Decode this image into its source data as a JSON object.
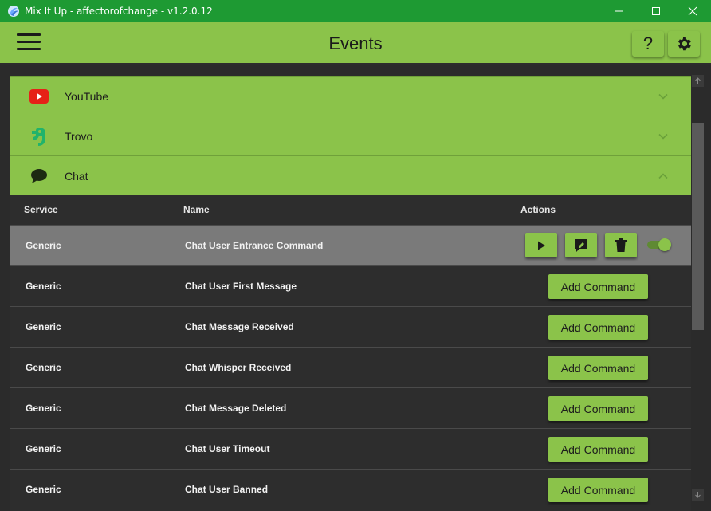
{
  "window": {
    "title": "Mix It Up - affectorofchange - v1.2.0.12"
  },
  "header": {
    "title": "Events",
    "help_label": "?"
  },
  "sections": [
    {
      "label": "YouTube",
      "icon": "youtube-icon",
      "expanded": false
    },
    {
      "label": "Trovo",
      "icon": "trovo-icon",
      "expanded": false
    },
    {
      "label": "Chat",
      "icon": "chat-bubble-icon",
      "expanded": true
    }
  ],
  "table": {
    "columns": [
      "Service",
      "Name",
      "Actions"
    ],
    "rows": [
      {
        "service": "Generic",
        "name": "Chat User Entrance Command",
        "has_command": true,
        "enabled": true
      },
      {
        "service": "Generic",
        "name": "Chat User First Message",
        "action": "Add Command"
      },
      {
        "service": "Generic",
        "name": "Chat Message Received",
        "action": "Add Command"
      },
      {
        "service": "Generic",
        "name": "Chat Whisper Received",
        "action": "Add Command"
      },
      {
        "service": "Generic",
        "name": "Chat Message Deleted",
        "action": "Add Command"
      },
      {
        "service": "Generic",
        "name": "Chat User Timeout",
        "action": "Add Command"
      },
      {
        "service": "Generic",
        "name": "Chat User Banned",
        "action": "Add Command"
      }
    ]
  },
  "colors": {
    "titlebar": "#1e9a33",
    "accent": "#8bc34a",
    "background": "#2b2b2b",
    "selected_row": "#7a7a7a"
  }
}
